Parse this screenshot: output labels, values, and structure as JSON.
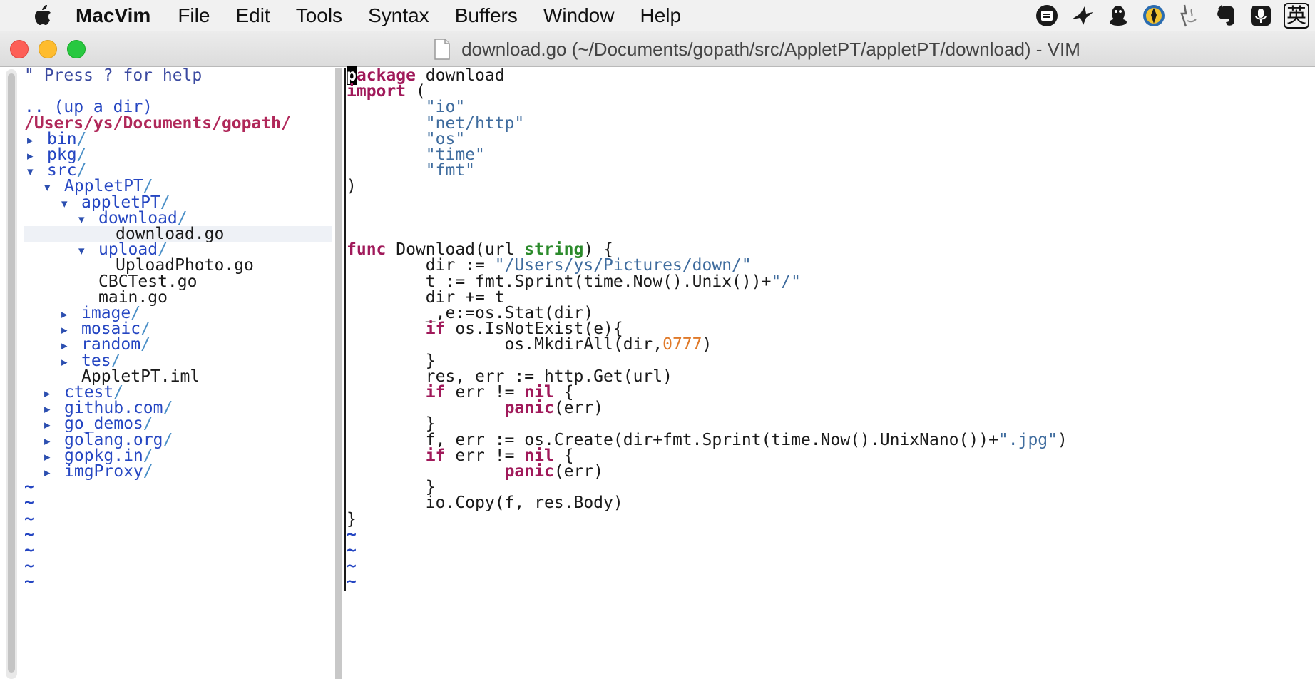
{
  "menubar": {
    "app_name": "MacVim",
    "items": [
      "File",
      "Edit",
      "Tools",
      "Syntax",
      "Buffers",
      "Window",
      "Help"
    ],
    "status_icons": [
      "cloud-note-icon",
      "bird-icon",
      "qq-penguin-icon",
      "pin-app-icon",
      "finder-face-icon",
      "evernote-icon",
      "microphone-icon"
    ],
    "ime_label": "英"
  },
  "window": {
    "title": "download.go (~/Documents/gopath/src/AppletPT/appletPT/download) - VIM"
  },
  "tree": {
    "help": "\" Press ? for help",
    "updir": ".. (up a dir)",
    "root": "/Users/ys/Documents/gopath/",
    "nodes": [
      {
        "indent": 0,
        "marker": "▸",
        "name": "bin",
        "type": "dir"
      },
      {
        "indent": 0,
        "marker": "▸",
        "name": "pkg",
        "type": "dir"
      },
      {
        "indent": 0,
        "marker": "▾",
        "name": "src",
        "type": "dir"
      },
      {
        "indent": 1,
        "marker": "▾",
        "name": "AppletPT",
        "type": "dir"
      },
      {
        "indent": 2,
        "marker": "▾",
        "name": "appletPT",
        "type": "dir"
      },
      {
        "indent": 3,
        "marker": "▾",
        "name": "download",
        "type": "dir"
      },
      {
        "indent": 4,
        "marker": "",
        "name": "download.go",
        "type": "file",
        "current": true
      },
      {
        "indent": 3,
        "marker": "▾",
        "name": "upload",
        "type": "dir"
      },
      {
        "indent": 4,
        "marker": "",
        "name": "UploadPhoto.go",
        "type": "file"
      },
      {
        "indent": 3,
        "marker": "",
        "name": "CBCTest.go",
        "type": "file"
      },
      {
        "indent": 3,
        "marker": "",
        "name": "main.go",
        "type": "file"
      },
      {
        "indent": 2,
        "marker": "▸",
        "name": "image",
        "type": "dir"
      },
      {
        "indent": 2,
        "marker": "▸",
        "name": "mosaic",
        "type": "dir"
      },
      {
        "indent": 2,
        "marker": "▸",
        "name": "random",
        "type": "dir"
      },
      {
        "indent": 2,
        "marker": "▸",
        "name": "tes",
        "type": "dir"
      },
      {
        "indent": 2,
        "marker": "",
        "name": "AppletPT.iml",
        "type": "file"
      },
      {
        "indent": 1,
        "marker": "▸",
        "name": "ctest",
        "type": "dir"
      },
      {
        "indent": 1,
        "marker": "▸",
        "name": "github.com",
        "type": "dir"
      },
      {
        "indent": 1,
        "marker": "▸",
        "name": "go_demos",
        "type": "dir"
      },
      {
        "indent": 1,
        "marker": "▸",
        "name": "golang.org",
        "type": "dir"
      },
      {
        "indent": 1,
        "marker": "▸",
        "name": "gopkg.in",
        "type": "dir"
      },
      {
        "indent": 1,
        "marker": "▸",
        "name": "imgProxy",
        "type": "dir"
      }
    ],
    "filler_lines": 7,
    "filler_char": "~"
  },
  "code": {
    "lines": [
      [
        [
          "cursor",
          "p"
        ],
        [
          "kw",
          "ackage"
        ],
        [
          "plain",
          " download"
        ]
      ],
      [
        [
          "kw",
          "import"
        ],
        [
          "plain",
          " ("
        ]
      ],
      [
        [
          "plain",
          "        "
        ],
        [
          "str",
          "\"io\""
        ]
      ],
      [
        [
          "plain",
          "        "
        ],
        [
          "str",
          "\"net/http\""
        ]
      ],
      [
        [
          "plain",
          "        "
        ],
        [
          "str",
          "\"os\""
        ]
      ],
      [
        [
          "plain",
          "        "
        ],
        [
          "str",
          "\"time\""
        ]
      ],
      [
        [
          "plain",
          "        "
        ],
        [
          "str",
          "\"fmt\""
        ]
      ],
      [
        [
          "plain",
          ")"
        ]
      ],
      [],
      [],
      [],
      [
        [
          "kw",
          "func"
        ],
        [
          "plain",
          " Download(url "
        ],
        [
          "typ",
          "string"
        ],
        [
          "plain",
          ") {"
        ]
      ],
      [
        [
          "plain",
          "        dir := "
        ],
        [
          "str",
          "\"/Users/ys/Pictures/down/\""
        ]
      ],
      [
        [
          "plain",
          "        t := fmt.Sprint(time.Now().Unix())+"
        ],
        [
          "str",
          "\"/\""
        ]
      ],
      [
        [
          "plain",
          "        dir += t"
        ]
      ],
      [
        [
          "plain",
          "        _,e:=os.Stat(dir)"
        ]
      ],
      [
        [
          "plain",
          "        "
        ],
        [
          "kw",
          "if"
        ],
        [
          "plain",
          " os.IsNotExist(e){"
        ]
      ],
      [
        [
          "plain",
          "                os.MkdirAll(dir,"
        ],
        [
          "num",
          "0777"
        ],
        [
          "plain",
          ")"
        ]
      ],
      [
        [
          "plain",
          "        }"
        ]
      ],
      [
        [
          "plain",
          "        res, err := http.Get(url)"
        ]
      ],
      [
        [
          "plain",
          "        "
        ],
        [
          "kw",
          "if"
        ],
        [
          "plain",
          " err != "
        ],
        [
          "kw",
          "nil"
        ],
        [
          "plain",
          " {"
        ]
      ],
      [
        [
          "plain",
          "                "
        ],
        [
          "kw",
          "panic"
        ],
        [
          "plain",
          "(err)"
        ]
      ],
      [
        [
          "plain",
          "        }"
        ]
      ],
      [
        [
          "plain",
          "        f, err := os.Create(dir+fmt.Sprint(time.Now().UnixNano())+"
        ],
        [
          "str",
          "\".jpg\""
        ],
        [
          "plain",
          ")"
        ]
      ],
      [
        [
          "plain",
          "        "
        ],
        [
          "kw",
          "if"
        ],
        [
          "plain",
          " err != "
        ],
        [
          "kw",
          "nil"
        ],
        [
          "plain",
          " {"
        ]
      ],
      [
        [
          "plain",
          "                "
        ],
        [
          "kw",
          "panic"
        ],
        [
          "plain",
          "(err)"
        ]
      ],
      [
        [
          "plain",
          "        }"
        ]
      ],
      [
        [
          "plain",
          "        io.Copy(f, res.Body)"
        ]
      ],
      [
        [
          "plain",
          "}"
        ]
      ]
    ],
    "filler_lines": 4,
    "filler_char": "~"
  }
}
